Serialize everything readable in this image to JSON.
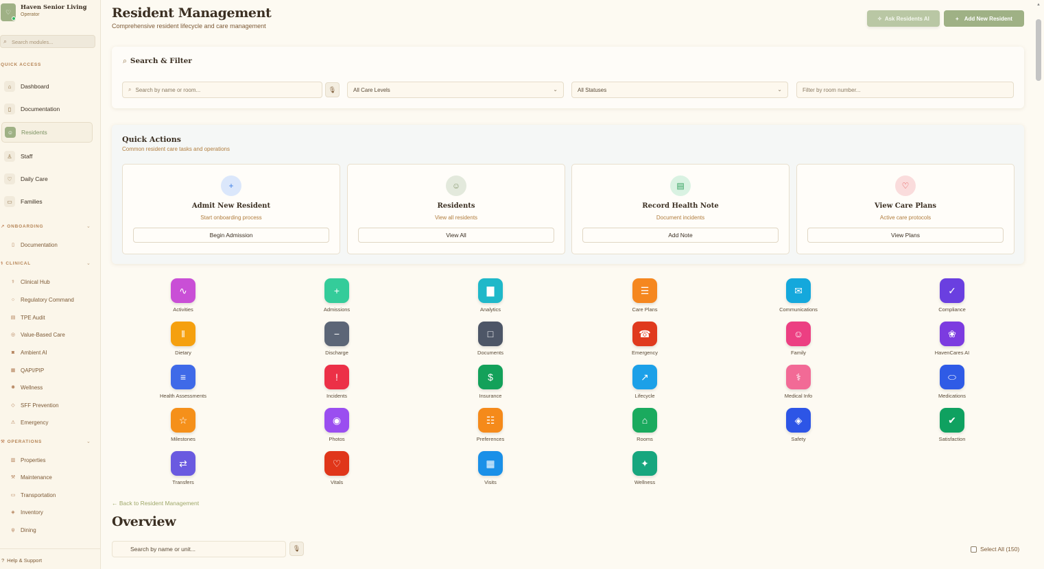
{
  "brand": {
    "name": "Haven Senior Living",
    "role": "Operator"
  },
  "sidebar": {
    "search_placeholder": "Search modules...",
    "quick_access_label": "QUICK ACCESS",
    "quick_access": [
      {
        "label": "Dashboard",
        "icon": "home-icon"
      },
      {
        "label": "Documentation",
        "icon": "book-icon"
      },
      {
        "label": "Residents",
        "icon": "users-icon",
        "active": true
      },
      {
        "label": "Staff",
        "icon": "user-check-icon"
      },
      {
        "label": "Daily Care",
        "icon": "heart-icon"
      },
      {
        "label": "Families",
        "icon": "message-icon"
      }
    ],
    "onboarding_label": "ONBOARDING",
    "onboarding": [
      {
        "label": "Documentation"
      }
    ],
    "clinical_label": "CLINICAL",
    "clinical": [
      {
        "label": "Clinical Hub"
      },
      {
        "label": "Regulatory Command"
      },
      {
        "label": "TPE Audit"
      },
      {
        "label": "Value-Based Care"
      },
      {
        "label": "Ambient AI"
      },
      {
        "label": "QAPI/PIP"
      },
      {
        "label": "Wellness"
      },
      {
        "label": "SFF Prevention"
      },
      {
        "label": "Emergency"
      }
    ],
    "operations_label": "OPERATIONS",
    "operations": [
      {
        "label": "Properties"
      },
      {
        "label": "Maintenance"
      },
      {
        "label": "Transportation"
      },
      {
        "label": "Inventory"
      },
      {
        "label": "Dining"
      }
    ],
    "help_label": "Help & Support"
  },
  "header": {
    "title": "Resident Management",
    "subtitle": "Comprehensive resident lifecycle and care management",
    "ask_label": "Ask Residents AI",
    "add_label": "Add New Resident"
  },
  "filters": {
    "title": "Search & Filter",
    "search_placeholder": "Search by name or room...",
    "care_level": "All Care Levels",
    "status": "All Statuses",
    "room_placeholder": "Filter by room number..."
  },
  "quick_actions": {
    "title": "Quick Actions",
    "subtitle": "Common resident care tasks and operations",
    "items": [
      {
        "name": "Admit New Resident",
        "desc": "Start onboarding process",
        "button": "Begin Admission",
        "icon": "user-plus-icon",
        "color": "#dbe7fb",
        "icon_color": "#3d7ee6"
      },
      {
        "name": "Residents",
        "desc": "View all residents",
        "button": "View All",
        "icon": "users-icon",
        "color": "#e3e9dc",
        "icon_color": "#8a9a72"
      },
      {
        "name": "Record Health Note",
        "desc": "Document incidents",
        "button": "Add Note",
        "icon": "file-text-icon",
        "color": "#d9f2e2",
        "icon_color": "#2e9e5a"
      },
      {
        "name": "View Care Plans",
        "desc": "Active care protocols",
        "button": "View Plans",
        "icon": "heart-icon",
        "color": "#fadcdc",
        "icon_color": "#e04848"
      }
    ]
  },
  "modules": [
    {
      "label": "Activities",
      "color": "#c94fd6",
      "glyph": "∿"
    },
    {
      "label": "Admissions",
      "color": "#34cc9a",
      "glyph": "+"
    },
    {
      "label": "Analytics",
      "color": "#1fb8c9",
      "glyph": "▇"
    },
    {
      "label": "Care Plans",
      "color": "#f5871f",
      "glyph": "☰"
    },
    {
      "label": "Communications",
      "color": "#14a8dc",
      "glyph": "✉"
    },
    {
      "label": "Compliance",
      "color": "#6a3fe0",
      "glyph": "✓"
    },
    {
      "label": "Dietary",
      "color": "#f5a00f",
      "glyph": "‖"
    },
    {
      "label": "Discharge",
      "color": "#5c6677",
      "glyph": "−"
    },
    {
      "label": "Documents",
      "color": "#4d5667",
      "glyph": "□"
    },
    {
      "label": "Emergency",
      "color": "#e03a1e",
      "glyph": "☎"
    },
    {
      "label": "Family",
      "color": "#ec3f82",
      "glyph": "☺"
    },
    {
      "label": "HavenCares AI",
      "color": "#7c3be0",
      "glyph": "❀"
    },
    {
      "label": "Health Assessments",
      "color": "#3f6ae8",
      "glyph": "≡"
    },
    {
      "label": "Incidents",
      "color": "#ec3047",
      "glyph": "!"
    },
    {
      "label": "Insurance",
      "color": "#13a15a",
      "glyph": "$"
    },
    {
      "label": "Lifecycle",
      "color": "#1ca0e8",
      "glyph": "↗"
    },
    {
      "label": "Medical Info",
      "color": "#f26a96",
      "glyph": "⚕"
    },
    {
      "label": "Medications",
      "color": "#2f5be6",
      "glyph": "⬭"
    },
    {
      "label": "Milestones",
      "color": "#f5901a",
      "glyph": "☆"
    },
    {
      "label": "Photos",
      "color": "#9a4ef0",
      "glyph": "◉"
    },
    {
      "label": "Preferences",
      "color": "#f58a1a",
      "glyph": "☷"
    },
    {
      "label": "Rooms",
      "color": "#1aaa5e",
      "glyph": "⌂"
    },
    {
      "label": "Safety",
      "color": "#2d55e6",
      "glyph": "◈"
    },
    {
      "label": "Satisfaction",
      "color": "#0fa160",
      "glyph": "✔"
    },
    {
      "label": "Transfers",
      "color": "#6a5ae0",
      "glyph": "⇄"
    },
    {
      "label": "Vitals",
      "color": "#e0361a",
      "glyph": "♡"
    },
    {
      "label": "Visits",
      "color": "#1a90e8",
      "glyph": "▦"
    },
    {
      "label": "Wellness",
      "color": "#17a67e",
      "glyph": "✦"
    }
  ],
  "overview": {
    "back_link": "← Back to Resident Management",
    "title": "Overview",
    "search_placeholder": "Search by name or unit...",
    "select_all": "Select All (150)"
  }
}
